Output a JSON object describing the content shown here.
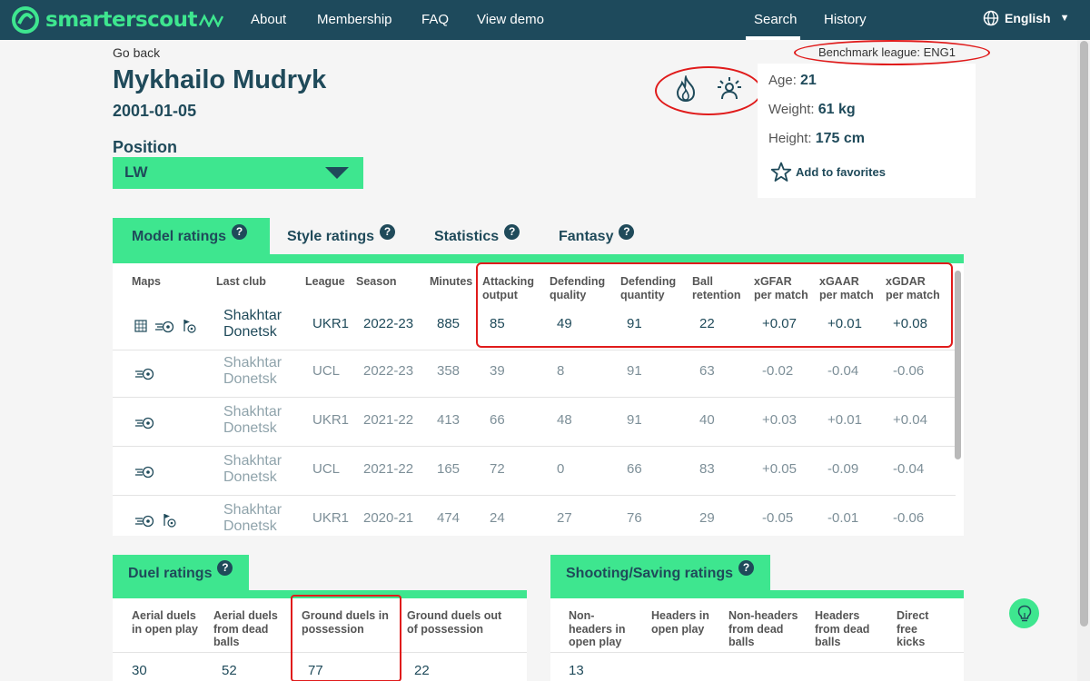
{
  "nav": {
    "logo_text": "smarterscout",
    "links": [
      "About",
      "Membership",
      "FAQ",
      "View demo"
    ],
    "search": "Search",
    "history": "History",
    "language": "English"
  },
  "header": {
    "go_back": "Go back",
    "name": "Mykhailo Mudryk",
    "dob": "2001-01-05",
    "position_label": "Position",
    "position_value": "LW",
    "benchmark": "Benchmark league: ENG1",
    "age_label": "Age:",
    "age": "21",
    "weight_label": "Weight:",
    "weight": "61 kg",
    "height_label": "Height:",
    "height": "175 cm",
    "favorites": "Add to favorites"
  },
  "tabs": [
    {
      "label": "Model ratings",
      "active": true
    },
    {
      "label": "Style ratings",
      "active": false
    },
    {
      "label": "Statistics",
      "active": false
    },
    {
      "label": "Fantasy",
      "active": false
    }
  ],
  "table": {
    "headers": {
      "maps": "Maps",
      "club": "Last club",
      "league": "League",
      "season": "Season",
      "minutes": "Minutes",
      "attacking": [
        "Attacking",
        "output"
      ],
      "def_quality": [
        "Defending",
        "quality"
      ],
      "def_quantity": [
        "Defending",
        "quantity"
      ],
      "ball": [
        "Ball",
        "retention"
      ],
      "xgfar": [
        "xGFAR",
        "per match"
      ],
      "xgaar": [
        "xGAAR",
        "per match"
      ],
      "xgdar": [
        "xGDAR",
        "per match"
      ]
    },
    "rows": [
      {
        "club1": "Shakhtar",
        "club2": "Donetsk",
        "league": "UKR1",
        "season": "2022-23",
        "minutes": "885",
        "att": "85",
        "dq": "49",
        "dqn": "91",
        "ball": "22",
        "xgfar": "+0.07",
        "xgaar": "+0.01",
        "xgdar": "+0.08"
      },
      {
        "club1": "Shakhtar",
        "club2": "Donetsk",
        "league": "UCL",
        "season": "2022-23",
        "minutes": "358",
        "att": "39",
        "dq": "8",
        "dqn": "91",
        "ball": "63",
        "xgfar": "-0.02",
        "xgaar": "-0.04",
        "xgdar": "-0.06"
      },
      {
        "club1": "Shakhtar",
        "club2": "Donetsk",
        "league": "UKR1",
        "season": "2021-22",
        "minutes": "413",
        "att": "66",
        "dq": "48",
        "dqn": "91",
        "ball": "40",
        "xgfar": "+0.03",
        "xgaar": "+0.01",
        "xgdar": "+0.04"
      },
      {
        "club1": "Shakhtar",
        "club2": "Donetsk",
        "league": "UCL",
        "season": "2021-22",
        "minutes": "165",
        "att": "72",
        "dq": "0",
        "dqn": "66",
        "ball": "83",
        "xgfar": "+0.05",
        "xgaar": "-0.09",
        "xgdar": "-0.04"
      },
      {
        "club1": "Shakhtar",
        "club2": "Donetsk",
        "league": "UKR1",
        "season": "2020-21",
        "minutes": "474",
        "att": "24",
        "dq": "27",
        "dqn": "76",
        "ball": "29",
        "xgfar": "-0.05",
        "xgaar": "-0.01",
        "xgdar": "-0.06"
      }
    ]
  },
  "duel": {
    "title": "Duel ratings",
    "headers": [
      [
        "Aerial duels",
        "in open play"
      ],
      [
        "Aerial duels",
        "from dead",
        "balls"
      ],
      [
        "Ground duels in",
        "possession"
      ],
      [
        "Ground duels out",
        "of possession"
      ]
    ],
    "values": [
      "30",
      "52",
      "77",
      "22"
    ]
  },
  "shooting": {
    "title": "Shooting/Saving ratings",
    "headers": [
      [
        "Non-",
        "headers in",
        "open play"
      ],
      [
        "Headers in",
        "open play"
      ],
      [
        "Non-headers",
        "from dead",
        "balls"
      ],
      [
        "Headers",
        "from dead",
        "balls"
      ],
      [
        "Direct",
        "free",
        "kicks"
      ]
    ],
    "values": [
      "13"
    ]
  },
  "colors": {
    "brand": "#3ee68f",
    "navy": "#1e4a5c",
    "annotation": "#e01b1b"
  }
}
